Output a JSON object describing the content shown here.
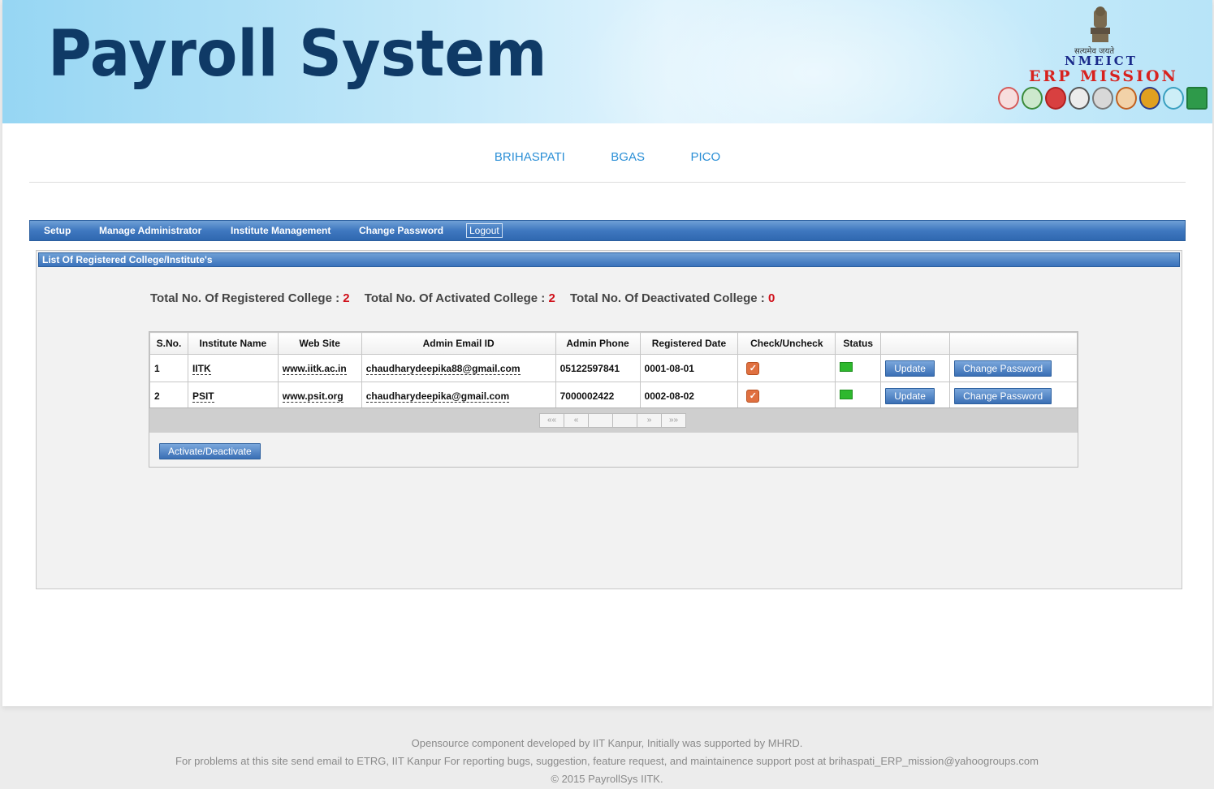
{
  "header": {
    "app_title": "Payroll System",
    "emblem_motto": "सत्यमेव जयते",
    "logo_line1": "NMEICT",
    "logo_line2": "ERP MISSION"
  },
  "topnav": [
    "BRIHASPATI",
    "BGAS",
    "PICO"
  ],
  "menu": {
    "setup": "Setup",
    "manage_admin": "Manage Administrator",
    "institute_mgmt": "Institute Management",
    "change_password": "Change Password",
    "logout": "Logout"
  },
  "panel": {
    "title": "List Of Registered College/Institute's",
    "stats": {
      "registered_label": "Total No. Of Registered College :",
      "registered_value": "2",
      "activated_label": "Total No. Of Activated College :",
      "activated_value": "2",
      "deactivated_label": "Total No. Of Deactivated College :",
      "deactivated_value": "0"
    },
    "table": {
      "columns": [
        "S.No.",
        "Institute Name",
        "Web Site",
        "Admin Email ID",
        "Admin Phone",
        "Registered Date",
        "Check/Uncheck",
        "Status",
        "",
        ""
      ],
      "rows": [
        {
          "sno": "1",
          "name": "IITK",
          "website": "www.iitk.ac.in",
          "email": "chaudharydeepika88@gmail.com",
          "phone": "05122597841",
          "date": "0001-08-01",
          "checked": true,
          "status_color": "#2eb82e",
          "update_label": "Update",
          "change_pw_label": "Change Password"
        },
        {
          "sno": "2",
          "name": "PSIT",
          "website": "www.psit.org",
          "email": "chaudharydeepika@gmail.com",
          "phone": "7000002422",
          "date": "0002-08-02",
          "checked": true,
          "status_color": "#2eb82e",
          "update_label": "Update",
          "change_pw_label": "Change Password"
        }
      ],
      "pager": [
        "««",
        "«",
        "",
        "",
        "»",
        "»»"
      ]
    },
    "activate_button": "Activate/Deactivate"
  },
  "footer": {
    "line1": "Opensource component developed by IIT Kanpur, Initially was supported by MHRD.",
    "line2": "For problems at this site send email to ETRG, IIT Kanpur For reporting bugs, suggestion, feature request, and maintainence support post at brihaspati_ERP_mission@yahoogroups.com",
    "line3": "© 2015 PayrollSys IITK."
  }
}
